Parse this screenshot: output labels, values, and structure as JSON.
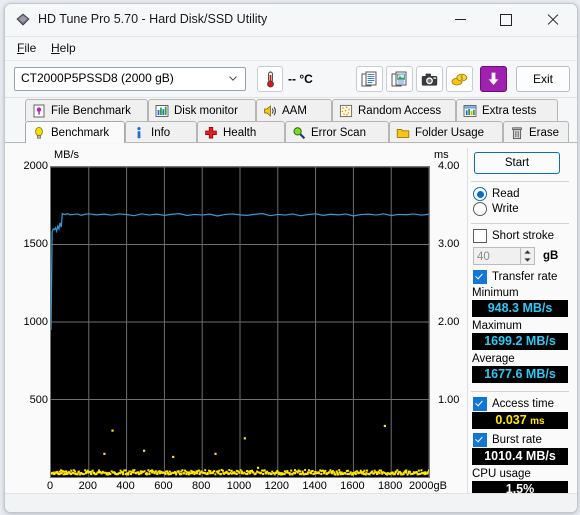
{
  "window": {
    "title": "HD Tune Pro 5.70 - Hard Disk/SSD Utility",
    "icon": "hdtune-logo-icon",
    "minimize": "minimize-icon",
    "maximize": "maximize-icon",
    "close": "close-icon"
  },
  "menu": {
    "items": [
      {
        "label": "File",
        "accel": "F",
        "rest": "ile"
      },
      {
        "label": "Help",
        "accel": "H",
        "rest": "elp"
      }
    ]
  },
  "toolbar": {
    "drive_selected": "CT2000P5PSSD8 (2000 gB)",
    "temperature": "--  °C",
    "exit_label": "Exit",
    "buttons": [
      "copy-text-icon",
      "copy-image-icon",
      "screenshot-icon",
      "donate-icon",
      "download-icon"
    ]
  },
  "tabs": {
    "row1": [
      {
        "label": "File Benchmark",
        "icon": "file-benchmark-icon",
        "active": false
      },
      {
        "label": "Disk monitor",
        "icon": "disk-monitor-icon",
        "active": false
      },
      {
        "label": "AAM",
        "icon": "aam-icon",
        "active": false
      },
      {
        "label": "Random Access",
        "icon": "random-access-icon",
        "active": false
      },
      {
        "label": "Extra tests",
        "icon": "extra-tests-icon",
        "active": false
      }
    ],
    "row2": [
      {
        "label": "Benchmark",
        "icon": "benchmark-icon",
        "active": true
      },
      {
        "label": "Info",
        "icon": "info-icon",
        "active": false
      },
      {
        "label": "Health",
        "icon": "health-icon",
        "active": false
      },
      {
        "label": "Error Scan",
        "icon": "error-scan-icon",
        "active": false
      },
      {
        "label": "Folder Usage",
        "icon": "folder-usage-icon",
        "active": false
      },
      {
        "label": "Erase",
        "icon": "erase-icon",
        "active": false
      }
    ]
  },
  "panel": {
    "start_label": "Start",
    "read_label": "Read",
    "write_label": "Write",
    "read_selected": true,
    "write_selected": false,
    "short_stroke_label": "Short stroke",
    "short_stroke_checked": false,
    "short_stroke_value": "40",
    "short_stroke_unit": "gB",
    "transfer_rate_label": "Transfer rate",
    "transfer_rate_checked": true,
    "minimum_label": "Minimum",
    "minimum_value": "948.3 MB/s",
    "maximum_label": "Maximum",
    "maximum_value": "1699.2 MB/s",
    "average_label": "Average",
    "average_value": "1677.6 MB/s",
    "access_time_label": "Access time",
    "access_time_checked": true,
    "access_time_value": "0.037",
    "access_time_unit": "ms",
    "burst_rate_label": "Burst rate",
    "burst_rate_checked": true,
    "burst_rate_value": "1010.4 MB/s",
    "cpu_usage_label": "CPU usage",
    "cpu_usage_value": "1.5%"
  },
  "colors": {
    "transfer_line": "#2e9fe0",
    "access_dots": "#ffe800",
    "readout_cyan": "#2ec8f5",
    "readout_yellow": "#ffe800",
    "plot_bg": "#000000",
    "grid": "#6e6e6e"
  },
  "chart_data": {
    "type": "line",
    "title": "",
    "ylabel": "MB/s",
    "y2label": "ms",
    "xlabel": "gB",
    "xlim": [
      0,
      2000
    ],
    "ylim": [
      0,
      2000
    ],
    "y2lim": [
      0,
      4.0
    ],
    "grid": true,
    "y_ticks": [
      500,
      1000,
      1500,
      2000
    ],
    "y2_ticks": [
      "1.00",
      "2.00",
      "3.00",
      "4.00"
    ],
    "x_ticks": [
      0,
      200,
      400,
      600,
      800,
      1000,
      1200,
      1400,
      1600,
      1800,
      2000
    ],
    "x_tick_labels": [
      "0",
      "200",
      "400",
      "600",
      "800",
      "1000",
      "1200",
      "1400",
      "1600",
      "1800",
      "2000gB"
    ],
    "series": [
      {
        "name": "Transfer rate",
        "axis": "left",
        "color": "#2e9fe0",
        "unit": "MB/s",
        "x": [
          0,
          6,
          12,
          18,
          24,
          30,
          36,
          42,
          48,
          54,
          60,
          70,
          80,
          90,
          100,
          120,
          140,
          160,
          180,
          200,
          240,
          280,
          320,
          360,
          400,
          440,
          480,
          520,
          560,
          600,
          640,
          680,
          720,
          760,
          800,
          840,
          880,
          920,
          960,
          1000,
          1040,
          1080,
          1120,
          1160,
          1200,
          1240,
          1280,
          1320,
          1360,
          1400,
          1440,
          1480,
          1520,
          1560,
          1600,
          1640,
          1680,
          1720,
          1760,
          1800,
          1840,
          1880,
          1920,
          1960,
          2000
        ],
        "y": [
          948.3,
          1580,
          1600,
          1596,
          1608,
          1586,
          1618,
          1601,
          1640,
          1612,
          1700,
          1694,
          1696,
          1699,
          1692,
          1694,
          1697,
          1688,
          1695,
          1698,
          1691,
          1696,
          1689,
          1697,
          1693,
          1686,
          1698,
          1690,
          1696,
          1688,
          1695,
          1699,
          1687,
          1694,
          1690,
          1696,
          1684,
          1693,
          1697,
          1691,
          1688,
          1695,
          1699,
          1686,
          1694,
          1690,
          1697,
          1685,
          1693,
          1698,
          1688,
          1695,
          1691,
          1697,
          1684,
          1693,
          1696,
          1690,
          1698,
          1687,
          1694,
          1692,
          1697,
          1689,
          1695
        ]
      },
      {
        "name": "Access time",
        "axis": "right",
        "color": "#ffe800",
        "unit": "ms",
        "style": "scatter",
        "x": [
          5,
          15,
          25,
          35,
          45,
          55,
          65,
          75,
          85,
          95,
          105,
          118,
          130,
          145,
          158,
          170,
          185,
          198,
          212,
          226,
          240,
          255,
          268,
          282,
          296,
          310,
          325,
          338,
          352,
          366,
          380,
          395,
          408,
          422,
          436,
          450,
          465,
          478,
          492,
          506,
          520,
          535,
          548,
          562,
          576,
          590,
          605,
          618,
          632,
          646,
          660,
          675,
          688,
          702,
          716,
          730,
          745,
          758,
          772,
          786,
          800,
          815,
          828,
          842,
          856,
          870,
          885,
          898,
          912,
          926,
          940,
          955,
          968,
          982,
          996,
          1010,
          1025,
          1038,
          1052,
          1066,
          1080,
          1095,
          1108,
          1122,
          1136,
          1150,
          1165,
          1178,
          1192,
          1206,
          1220,
          1235,
          1248,
          1262,
          1276,
          1290,
          1305,
          1318,
          1332,
          1346,
          1360,
          1375,
          1388,
          1402,
          1416,
          1430,
          1445,
          1458,
          1472,
          1486,
          1500,
          1515,
          1528,
          1542,
          1556,
          1570,
          1585,
          1598,
          1612,
          1626,
          1640,
          1655,
          1668,
          1682,
          1696,
          1710,
          1725,
          1738,
          1752,
          1766,
          1780,
          1795,
          1808,
          1822,
          1836,
          1850,
          1865,
          1878,
          1892,
          1906,
          1920,
          1935,
          1948,
          1962,
          1976,
          1990
        ],
        "y": [
          0.05,
          0.04,
          0.06,
          0.05,
          0.04,
          0.05,
          0.07,
          0.04,
          0.05,
          0.06,
          0.04,
          0.05,
          0.04,
          0.06,
          0.05,
          0.04,
          0.05,
          0.06,
          0.04,
          0.05,
          0.04,
          0.06,
          0.05,
          0.3,
          0.05,
          0.04,
          0.6,
          0.05,
          0.04,
          0.05,
          0.06,
          0.04,
          0.05,
          0.04,
          0.06,
          0.05,
          0.04,
          0.05,
          0.34,
          0.05,
          0.04,
          0.06,
          0.05,
          0.04,
          0.05,
          0.06,
          0.04,
          0.05,
          0.04,
          0.26,
          0.05,
          0.06,
          0.04,
          0.05,
          0.04,
          0.06,
          0.05,
          0.04,
          0.05,
          0.04,
          0.06,
          0.05,
          0.04,
          0.05,
          0.06,
          0.3,
          0.05,
          0.04,
          0.05,
          0.06,
          0.04,
          0.08,
          0.05,
          0.04,
          0.06,
          0.05,
          0.5,
          0.04,
          0.05,
          0.06,
          0.04,
          0.12,
          0.05,
          0.04,
          0.06,
          0.05,
          0.04,
          0.05,
          0.06,
          0.04,
          0.05,
          0.04,
          0.06,
          0.05,
          0.04,
          0.05,
          0.06,
          0.04,
          0.05,
          0.04,
          0.06,
          0.05,
          0.04,
          0.05,
          0.06,
          0.04,
          0.05,
          0.04,
          0.06,
          0.05,
          0.04,
          0.05,
          0.06,
          0.04,
          0.05,
          0.04,
          0.06,
          0.05,
          0.04,
          0.05,
          0.06,
          0.04,
          0.05,
          0.04,
          0.06,
          0.05,
          0.04,
          0.05,
          0.06,
          0.66,
          0.05,
          0.04,
          0.05,
          0.06,
          0.04,
          0.05,
          0.04,
          0.06,
          0.05,
          0.04,
          0.05,
          0.06,
          0.04,
          0.05,
          0.04,
          0.05,
          0.06
        ]
      }
    ]
  }
}
